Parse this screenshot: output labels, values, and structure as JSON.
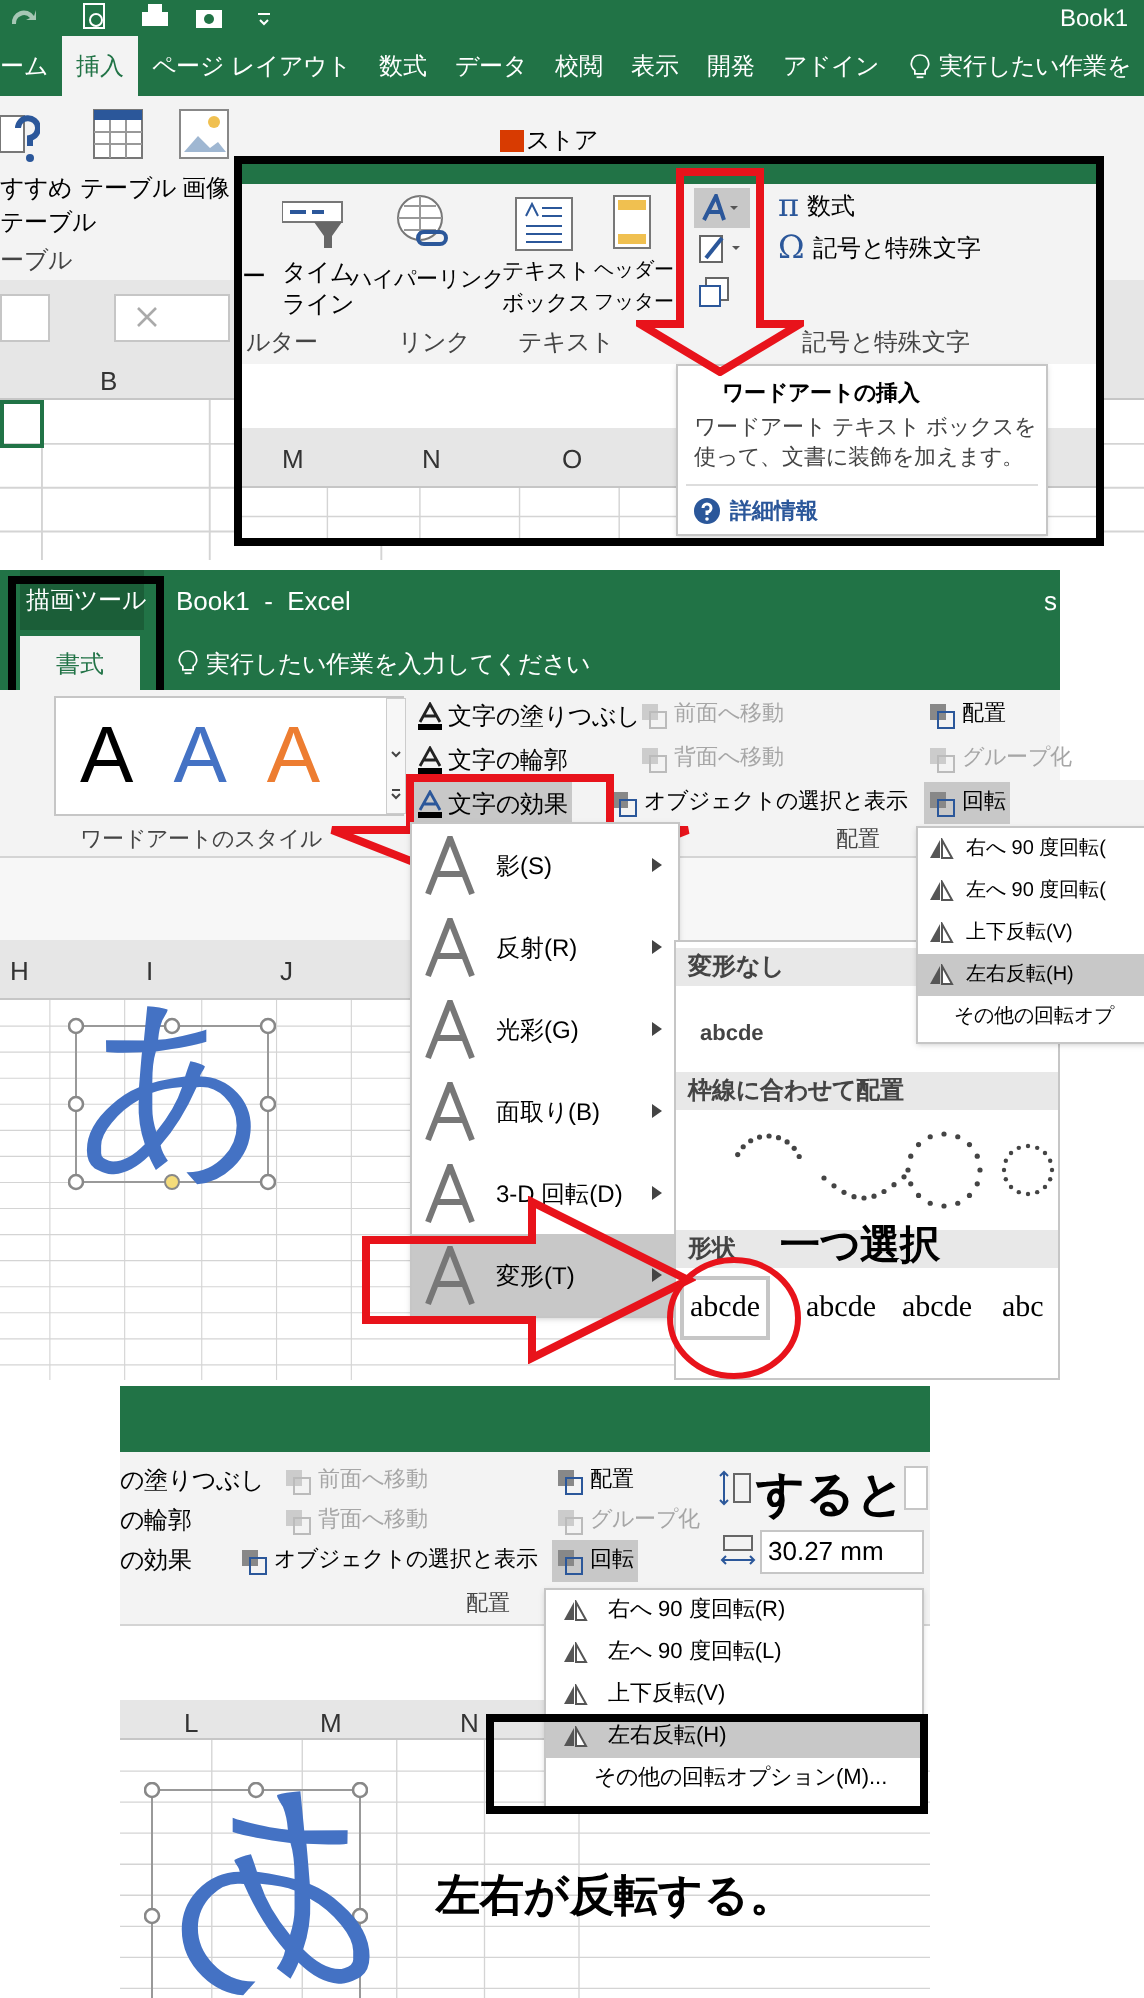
{
  "screen_1": {
    "title": "Book1",
    "tabs": [
      {
        "label": "ーム",
        "selected": false
      },
      {
        "label": "挿入",
        "selected": true
      },
      {
        "label": "ページ レイアウト",
        "selected": false
      },
      {
        "label": "数式",
        "selected": false
      },
      {
        "label": "データ",
        "selected": false
      },
      {
        "label": "校閲",
        "selected": false
      },
      {
        "label": "表示",
        "selected": false
      },
      {
        "label": "開発",
        "selected": false
      },
      {
        "label": "アドイン",
        "selected": false
      }
    ],
    "tell_me": "実行したい作業を",
    "pivot_table": [
      "すすめ",
      "テーブル"
    ],
    "ribbon_buttons": [
      "テーブル",
      "画像"
    ],
    "store": "ストア",
    "group_label": "ーブル",
    "columns": [
      "B"
    ],
    "inset": {
      "buttons": [
        {
          "lines": [
            "ー"
          ]
        },
        {
          "lines": [
            "タイム",
            "ライン"
          ]
        },
        {
          "lines": [
            "ハイパーリンク"
          ]
        },
        {
          "lines": [
            "テキスト",
            "ボックス"
          ]
        },
        {
          "lines": [
            "ヘッダー",
            "フッター"
          ]
        }
      ],
      "symbol_buttons": [
        {
          "icon": "π",
          "label": "数式"
        },
        {
          "icon": "Ω",
          "label": "記号と特殊文字"
        }
      ],
      "group_labels": [
        "ルター",
        "リンク",
        "テキスト",
        "記号と特殊文字"
      ],
      "columns": [
        "M",
        "N",
        "O"
      ],
      "tooltip": {
        "title": "ワードアートの挿入",
        "body": "ワードアート テキスト ボックスを使って、文書に装飾を加えます。",
        "link": "詳細情報"
      }
    }
  },
  "screen_2": {
    "context_tab": "描画ツール",
    "title": "Book1  -  Excel",
    "user": "s",
    "tabs": [
      {
        "label": "書式",
        "selected": true
      }
    ],
    "tell_me": "実行したい作業を入力してください",
    "styles": [
      {
        "label": "A",
        "color": "#000000"
      },
      {
        "label": "A",
        "color": "#4472c4"
      },
      {
        "label": "A",
        "color": "#ed7d31"
      }
    ],
    "text_commands": [
      {
        "label": "文字の塗りつぶし",
        "selected": false
      },
      {
        "label": "文字の輪郭",
        "selected": false
      },
      {
        "label": "文字の効果",
        "selected": true
      }
    ],
    "order_commands": [
      {
        "label": "前面へ移動",
        "disabled": true
      },
      {
        "label": "背面へ移動",
        "disabled": true
      },
      {
        "label": "オブジェクトの選択と表示",
        "disabled": false
      }
    ],
    "arrange_commands": [
      {
        "label": "配置",
        "disabled": false
      },
      {
        "label": "グループ化",
        "disabled": true
      },
      {
        "label": "回転",
        "disabled": false
      }
    ],
    "group_labels": [
      "ワードアートのスタイル",
      "配置"
    ],
    "effects_menu": [
      {
        "label": "影(S)",
        "selected": false
      },
      {
        "label": "反射(R)",
        "selected": false
      },
      {
        "label": "光彩(G)",
        "selected": false
      },
      {
        "label": "面取り(B)",
        "selected": false
      },
      {
        "label": "3-D 回転(D)",
        "selected": false
      },
      {
        "label": "変形(T)",
        "selected": true
      }
    ],
    "transform": {
      "sections": [
        "変形なし",
        "枠線に合わせて配置",
        "形状"
      ],
      "plain_sample": "abcde",
      "shape_samples": [
        {
          "label": "abcde",
          "selected": true
        },
        {
          "label": "abcde",
          "selected": false
        },
        {
          "label": "abcde",
          "selected": false
        },
        {
          "label": "abc",
          "selected": false
        }
      ]
    },
    "rotate_menu": [
      {
        "label": "右へ 90 度回転(",
        "selected": false
      },
      {
        "label": "左へ 90 度回転(",
        "selected": false
      },
      {
        "label": "上下反転(V)",
        "selected": false
      },
      {
        "label": "左右反転(H)",
        "selected": true
      },
      {
        "label": "その他の回転オプ",
        "selected": false
      }
    ],
    "columns": [
      "H",
      "I",
      "J"
    ],
    "wordart": "あ",
    "note": "一つ選択"
  },
  "screen_3": {
    "text_commands": [
      "の塗りつぶし",
      "の輪郭",
      "の効果"
    ],
    "order_commands": [
      {
        "label": "前面へ移動",
        "disabled": true
      },
      {
        "label": "背面へ移動",
        "disabled": true
      },
      {
        "label": "オブジェクトの選択と表示",
        "disabled": false
      }
    ],
    "arrange_commands": [
      {
        "label": "配置",
        "disabled": false
      },
      {
        "label": "グループ化",
        "disabled": true
      },
      {
        "label": "回転",
        "disabled": false
      }
    ],
    "group_label": "配置",
    "width_field": "30.27 mm",
    "rotate_menu": [
      {
        "label": "右へ 90 度回転(R)",
        "selected": false
      },
      {
        "label": "左へ 90 度回転(L)",
        "selected": false
      },
      {
        "label": "上下反転(V)",
        "selected": false
      },
      {
        "label": "左右反転(H)",
        "selected": true
      },
      {
        "label": "その他の回転オプション(M)...",
        "selected": false
      }
    ],
    "columns": [
      "L",
      "M",
      "N"
    ],
    "wordart": "あ",
    "notes": [
      "すると",
      "左右が反転する。"
    ]
  }
}
